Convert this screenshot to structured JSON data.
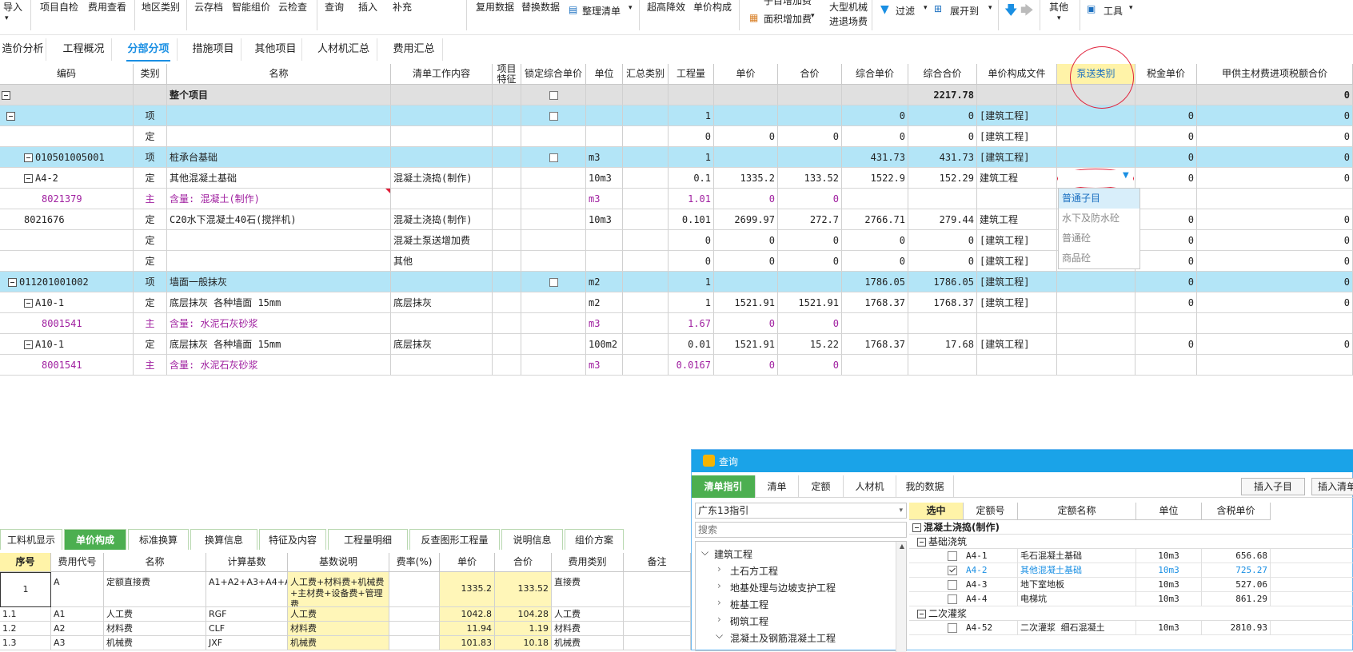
{
  "toolbar": {
    "items": [
      "导入",
      "项目自检",
      "费用查看",
      "地区类别",
      "云存档",
      "智能组价",
      "云检查",
      "查询",
      "插入",
      "补充",
      "复用数据",
      "替换数据",
      "整理清单",
      "超高降效",
      "单价构成",
      "子目增加费",
      "面积增加费",
      "大型机械",
      "进退场费",
      "过滤",
      "展开到",
      "其他",
      "工具"
    ]
  },
  "main_tabs": [
    "造价分析",
    "工程概况",
    "分部分项",
    "措施项目",
    "其他项目",
    "人材机汇总",
    "费用汇总"
  ],
  "columns": [
    "编码",
    "类别",
    "名称",
    "清单工作内容",
    "项目特征",
    "锁定综合单价",
    "单位",
    "汇总类别",
    "工程量",
    "单价",
    "合价",
    "综合单价",
    "综合合价",
    "单价构成文件",
    "泵送类别",
    "税金单价",
    "甲供主材费进项税额合价"
  ],
  "rows": [
    {
      "code": "",
      "type": "",
      "name": "整个项目",
      "work": "",
      "unit": "",
      "qty": "",
      "price": "",
      "total": "",
      "uprice": "",
      "utotal": "2217.78",
      "file": "",
      "tax": "",
      "last": "0"
    },
    {
      "code": "",
      "type": "项",
      "name": "",
      "work": "",
      "unit": "",
      "qty": "1",
      "price": "",
      "total": "",
      "uprice": "0",
      "utotal": "0",
      "file": "[建筑工程]",
      "tax": "0",
      "last": "0"
    },
    {
      "code": "",
      "type": "定",
      "name": "",
      "work": "",
      "unit": "",
      "qty": "0",
      "price": "0",
      "total": "0",
      "uprice": "0",
      "utotal": "0",
      "file": "[建筑工程]",
      "tax": "0",
      "last": "0"
    },
    {
      "code": "010501005001",
      "type": "项",
      "name": "桩承台基础",
      "work": "",
      "unit": "m3",
      "qty": "1",
      "price": "",
      "total": "",
      "uprice": "431.73",
      "utotal": "431.73",
      "file": "[建筑工程]",
      "tax": "0",
      "last": "0"
    },
    {
      "code": "A4-2",
      "type": "定",
      "name": "其他混凝土基础",
      "work": "混凝土浇捣(制作)",
      "unit": "10m3",
      "qty": "0.1",
      "price": "1335.2",
      "total": "133.52",
      "uprice": "1522.9",
      "utotal": "152.29",
      "file": "建筑工程",
      "tax": "0",
      "last": "0"
    },
    {
      "code": "8021379",
      "type": "主",
      "name": "含量: 混凝土(制作)",
      "work": "",
      "unit": "m3",
      "qty": "1.01",
      "price": "0",
      "total": "0",
      "uprice": "",
      "utotal": "",
      "file": "",
      "tax": "",
      "last": ""
    },
    {
      "code": "8021676",
      "type": "定",
      "name": "C20水下混凝土40石(搅拌机)",
      "work": "混凝土浇捣(制作)",
      "unit": "10m3",
      "qty": "0.101",
      "price": "2699.97",
      "total": "272.7",
      "uprice": "2766.71",
      "utotal": "279.44",
      "file": "建筑工程",
      "tax": "0",
      "last": "0"
    },
    {
      "code": "",
      "type": "定",
      "name": "",
      "work": "混凝土泵送增加费",
      "unit": "",
      "qty": "0",
      "price": "0",
      "total": "0",
      "uprice": "0",
      "utotal": "0",
      "file": "[建筑工程]",
      "tax": "0",
      "last": "0"
    },
    {
      "code": "",
      "type": "定",
      "name": "",
      "work": "其他",
      "unit": "",
      "qty": "0",
      "price": "0",
      "total": "0",
      "uprice": "0",
      "utotal": "0",
      "file": "[建筑工程]",
      "tax": "0",
      "last": "0"
    },
    {
      "code": "011201001002",
      "type": "项",
      "name": "墙面一般抹灰",
      "work": "",
      "unit": "m2",
      "qty": "1",
      "price": "",
      "total": "",
      "uprice": "1786.05",
      "utotal": "1786.05",
      "file": "[建筑工程]",
      "tax": "0",
      "last": "0"
    },
    {
      "code": "A10-1",
      "type": "定",
      "name": "底层抹灰 各种墙面 15mm",
      "work": "底层抹灰",
      "unit": "m2",
      "qty": "1",
      "price": "1521.91",
      "total": "1521.91",
      "uprice": "1768.37",
      "utotal": "1768.37",
      "file": "[建筑工程]",
      "tax": "0",
      "last": "0"
    },
    {
      "code": "8001541",
      "type": "主",
      "name": "含量: 水泥石灰砂浆",
      "work": "",
      "unit": "m3",
      "qty": "1.67",
      "price": "0",
      "total": "0",
      "uprice": "",
      "utotal": "",
      "file": "",
      "tax": "",
      "last": ""
    },
    {
      "code": "A10-1",
      "type": "定",
      "name": "底层抹灰 各种墙面 15mm",
      "work": "底层抹灰",
      "unit": "100m2",
      "qty": "0.01",
      "price": "1521.91",
      "total": "15.22",
      "uprice": "1768.37",
      "utotal": "17.68",
      "file": "[建筑工程]",
      "tax": "0",
      "last": "0"
    },
    {
      "code": "8001541",
      "type": "主",
      "name": "含量: 水泥石灰砂浆",
      "work": "",
      "unit": "m3",
      "qty": "0.0167",
      "price": "0",
      "total": "0",
      "uprice": "",
      "utotal": "",
      "file": "",
      "tax": "",
      "last": ""
    }
  ],
  "pump_dropdown": {
    "options": [
      "普通子目",
      "水下及防水砼",
      "普通砼",
      "商品砼"
    ]
  },
  "bottom_tabs": [
    "工料机显示",
    "单价构成",
    "标准换算",
    "换算信息",
    "特征及内容",
    "工程量明细",
    "反查图形工程量",
    "说明信息",
    "组价方案"
  ],
  "bottom_columns": [
    "序号",
    "费用代号",
    "名称",
    "计算基数",
    "基数说明",
    "费率(%)",
    "单价",
    "合价",
    "费用类别",
    "备注"
  ],
  "bottom_rows": [
    {
      "no": "1",
      "code": "A",
      "name": "定额直接费",
      "base": "A1+A2+A3+A4+A5+A6",
      "desc": "人工费+材料费+机械费+主材费+设备费+管理费",
      "rate": "",
      "price": "1335.2",
      "total": "133.52",
      "cat": "直接费"
    },
    {
      "no": "1.1",
      "code": "A1",
      "name": "人工费",
      "base": "RGF",
      "desc": "人工费",
      "rate": "",
      "price": "1042.8",
      "total": "104.28",
      "cat": "人工费"
    },
    {
      "no": "1.2",
      "code": "A2",
      "name": "材料费",
      "base": "CLF",
      "desc": "材料费",
      "rate": "",
      "price": "11.94",
      "total": "1.19",
      "cat": "材料费"
    },
    {
      "no": "1.3",
      "code": "A3",
      "name": "机械费",
      "base": "JXF",
      "desc": "机械费",
      "rate": "",
      "price": "101.83",
      "total": "10.18",
      "cat": "机械费"
    }
  ],
  "query_panel": {
    "title": "查询",
    "tabs": [
      "清单指引",
      "清单",
      "定额",
      "人材机",
      "我的数据"
    ],
    "insert_sub": "插入子目",
    "insert_list": "插入清单",
    "region": "广东13指引",
    "search_placeholder": "搜索",
    "tree": [
      "建筑工程",
      "土石方工程",
      "地基处理与边坡支护工程",
      "桩基工程",
      "砌筑工程",
      "混凝土及钢筋混凝土工程"
    ],
    "columns": [
      "选中",
      "定额号",
      "定额名称",
      "单位",
      "含税单价"
    ],
    "group1": "混凝土浇捣(制作)",
    "group1_sub": "基础浇筑",
    "items": [
      {
        "code": "A4-1",
        "name": "毛石混凝土基础",
        "unit": "10m3",
        "price": "656.68",
        "checked": false
      },
      {
        "code": "A4-2",
        "name": "其他混凝土基础",
        "unit": "10m3",
        "price": "725.27",
        "checked": true
      },
      {
        "code": "A4-3",
        "name": "地下室地板",
        "unit": "10m3",
        "price": "527.06",
        "checked": false
      },
      {
        "code": "A4-4",
        "name": "电梯坑",
        "unit": "10m3",
        "price": "861.29",
        "checked": false
      }
    ],
    "group2": "二次灌浆",
    "items2": [
      {
        "code": "A4-52",
        "name": "二次灌浆 细石混凝土",
        "unit": "10m3",
        "price": "2810.93",
        "checked": false
      }
    ]
  },
  "colors": {
    "accent": "#1a8fe3",
    "row_highlight": "#b3e5f7",
    "header_yellow": "#fff3a8",
    "green": "#4caf50",
    "annotation_red": "#e0203a"
  }
}
